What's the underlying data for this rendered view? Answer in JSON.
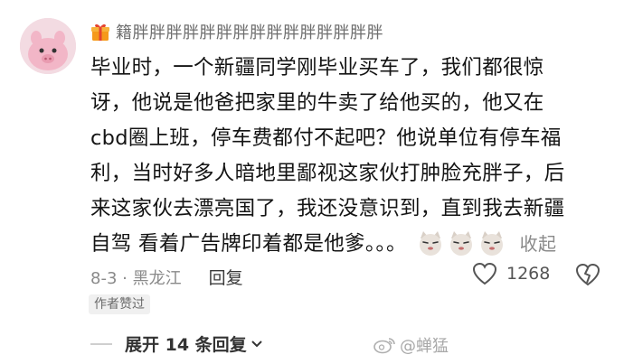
{
  "comment": {
    "username": "籍胖胖胖胖胖胖胖胖胖胖胖胖胖胖胖",
    "text_lines": [
      "毕业时，一个新疆同学刚毕业买车了，我们都很惊",
      "讶，他说是他爸把家里的牛卖了给他买的，他又在",
      "cbd圈上班，停车费都付不起吧？他说单位有停车福",
      "利，当时好多人暗地里鄙视这家伙打肿脸充胖子，后",
      "来这家伙去漂亮国了，我还没意识到，直到我去新疆"
    ],
    "text_last": "自驾 看着广告牌印着都是他爹。。。",
    "collapse_label": "收起",
    "date_location": "8-3 · 黑龙江",
    "reply_label": "回复",
    "like_count": "1268",
    "author_liked_badge": "作者赞过"
  },
  "replies": {
    "expand_label": "展开 14 条回复"
  },
  "watermark": {
    "text": "@蝉猛"
  },
  "colors": {
    "meta_gray": "#8a8a8a",
    "text": "#141414",
    "avatar_bg": "#f3dbe2",
    "pig_pink": "#f2b6c7"
  }
}
